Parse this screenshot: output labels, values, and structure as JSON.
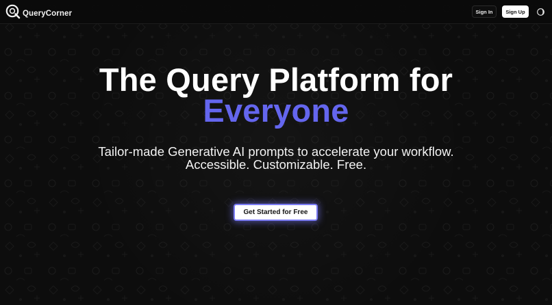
{
  "brand": {
    "name": "QueryCorner",
    "logo_icon": "q-logo-icon"
  },
  "header": {
    "sign_in_label": "Sign In",
    "sign_up_label": "Sign Up",
    "theme_toggle_icon": "theme-toggle-icon"
  },
  "hero": {
    "headline_line1": "The Query Platform for",
    "headline_line2": "Everyone",
    "subtitle_line1": "Tailor-made Generative AI prompts to accelerate your workflow.",
    "subtitle_line2": "Accessible. Customizable. Free.",
    "cta_label": "Get Started for Free"
  },
  "colors": {
    "background": "#0d0d0d",
    "accent": "#6466ee",
    "cta_glow": "#7b7cf5",
    "text": "#ffffff"
  }
}
